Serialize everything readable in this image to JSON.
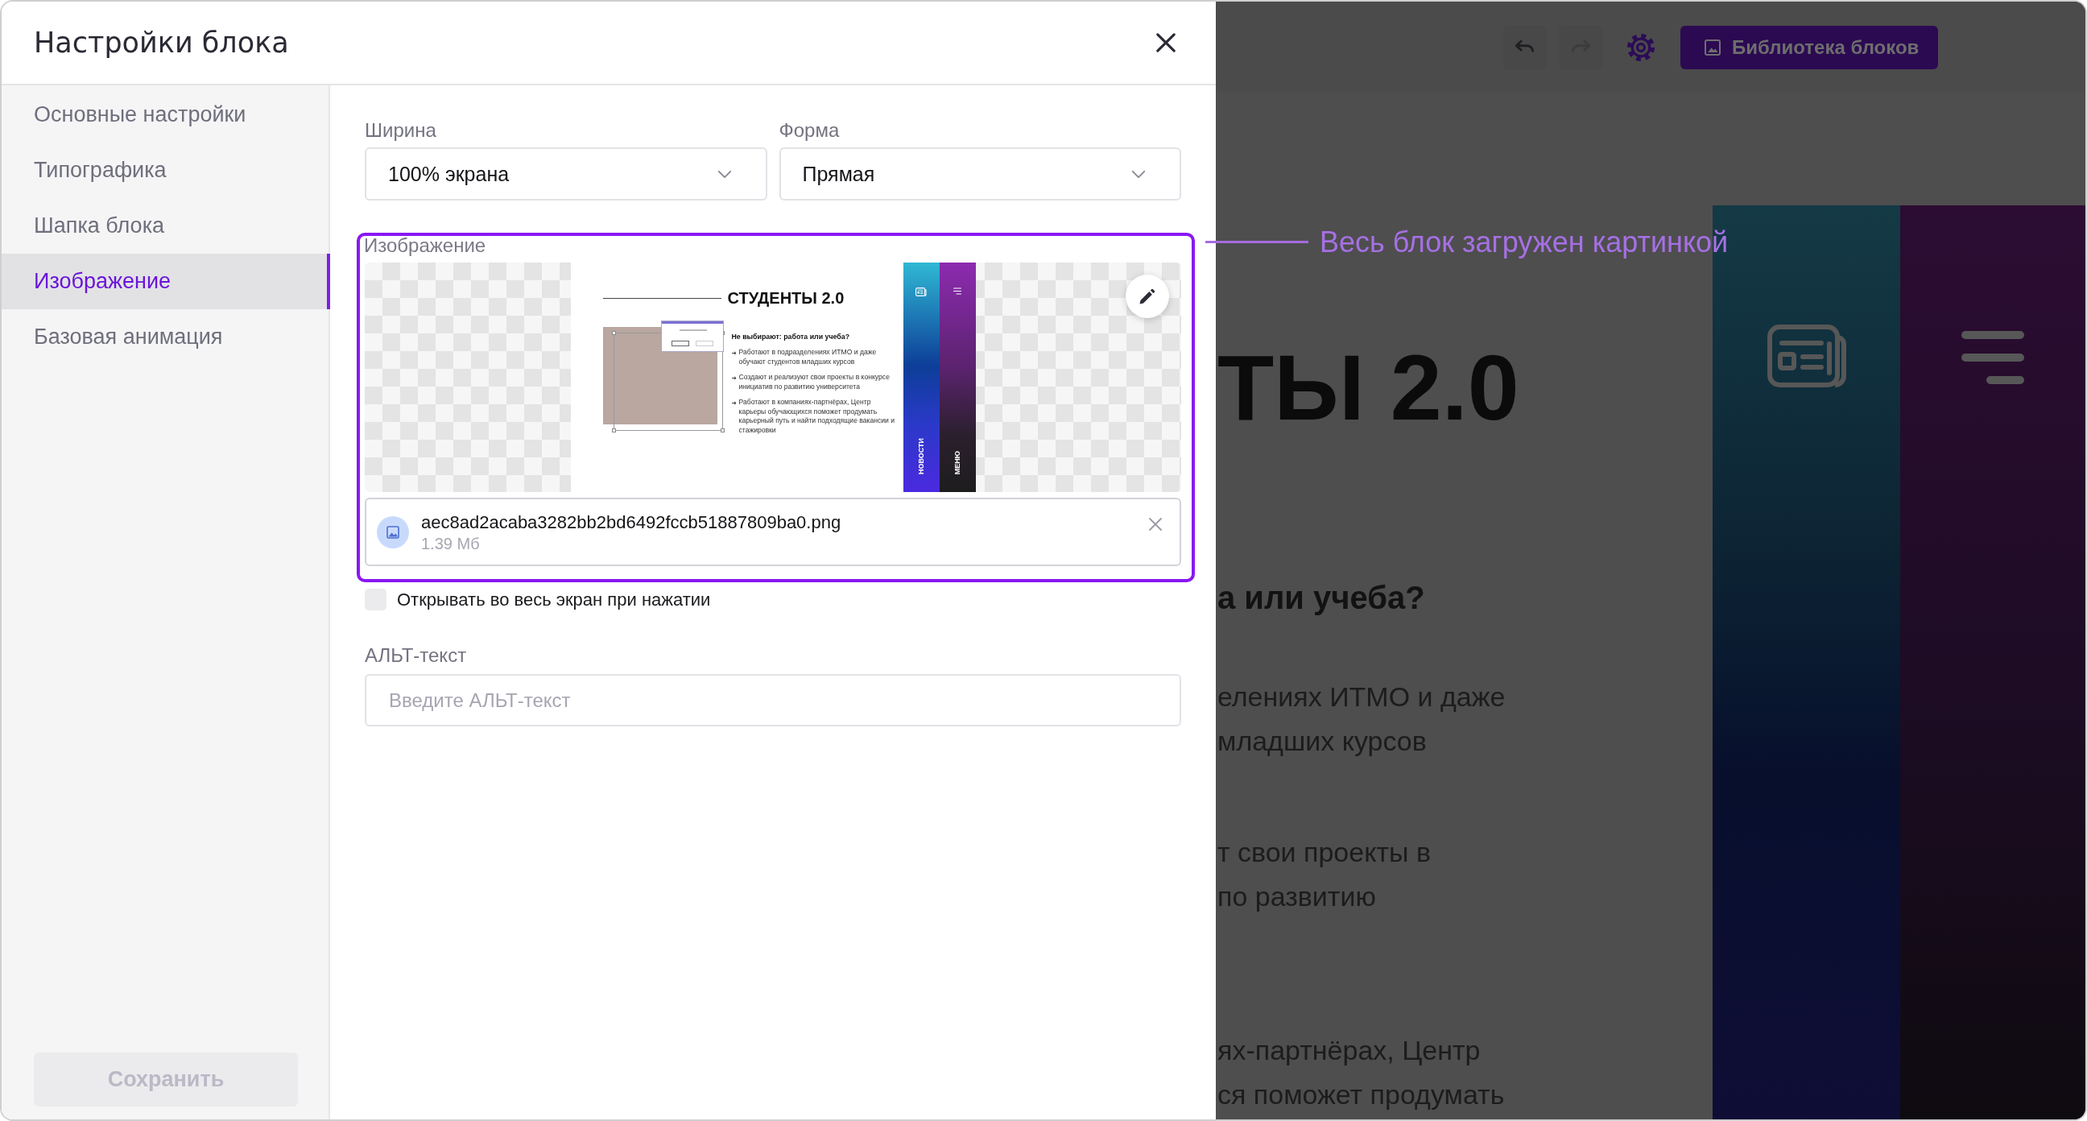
{
  "dialog": {
    "title": "Настройки блока"
  },
  "sidebar": {
    "items": [
      {
        "label": "Основные настройки",
        "selected": false
      },
      {
        "label": "Типографика",
        "selected": false
      },
      {
        "label": "Шапка блока",
        "selected": false
      },
      {
        "label": "Изображение",
        "selected": true
      },
      {
        "label": "Базовая анимация",
        "selected": false
      }
    ],
    "save_button": {
      "label": "Сохранить",
      "disabled": true
    }
  },
  "form": {
    "width": {
      "label": "Ширина",
      "value": "100% экрана"
    },
    "shape": {
      "label": "Форма",
      "value": "Прямая"
    },
    "image": {
      "label": "Изображение",
      "highlighted": true,
      "preview": {
        "title": "СТУДЕНТЫ 2.0",
        "question": "Не выбирают: работа или учеба?",
        "bullets": [
          "Работают в подразделениях ИТМО и даже обучают студентов младших курсов",
          "Создают и реализуют свои проекты в конкурсе инициатив по развитию университета",
          "Работают в компаниях-партнёрах, Центр карьеры обучающихся поможет продумать карьерный путь и найти подходящие вакансии и стажировки"
        ],
        "side_tabs": [
          {
            "label": "НОВОСТИ",
            "kind": "news"
          },
          {
            "label": "МЕНЮ",
            "kind": "menu"
          }
        ]
      },
      "file": {
        "name": "aec8ad2acaba3282bb2bd6492fccb51887809ba0.png",
        "size": "1.39 Мб"
      }
    },
    "fullscreen": {
      "label": "Открывать во весь экран при нажатии",
      "checked": false
    },
    "alt_text": {
      "label": "АЛЬТ-текст",
      "placeholder": "Введите АЛЬТ-текст"
    }
  },
  "annotation": {
    "text": "Весь блок загружен картинкой"
  },
  "background_page": {
    "undo_button": {
      "disabled": false
    },
    "redo_button": {
      "disabled": true
    },
    "library_button": {
      "label": "Библиотека блоков"
    },
    "heading": "ТЫ 2.0",
    "subheading": "а или учеба?",
    "paragraphs": [
      [
        "елениях ИТМО и даже",
        "младших курсов"
      ],
      [
        "т свои проекты в",
        "по развитию"
      ],
      [
        "ях-партнёрах, Центр",
        "ся поможет продумать"
      ]
    ]
  }
}
